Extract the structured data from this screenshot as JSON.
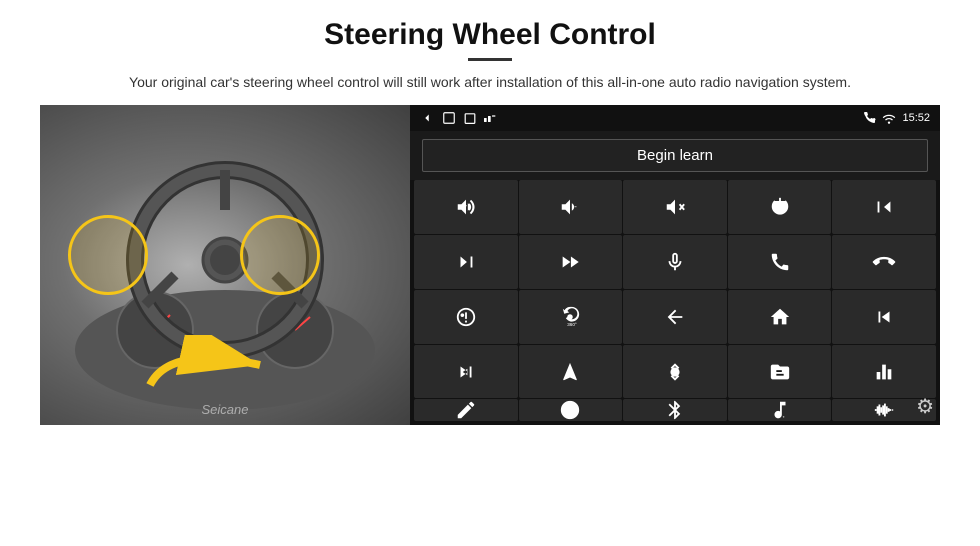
{
  "page": {
    "title": "Steering Wheel Control",
    "subtitle": "Your original car's steering wheel control will still work after installation of this all-in-one auto radio navigation system.",
    "status_bar": {
      "time": "15:52",
      "nav_icons": [
        "back",
        "home",
        "recents",
        "signal"
      ]
    },
    "begin_learn_btn": "Begin learn",
    "watermark": "Seicane",
    "gear_icon": "⚙"
  }
}
